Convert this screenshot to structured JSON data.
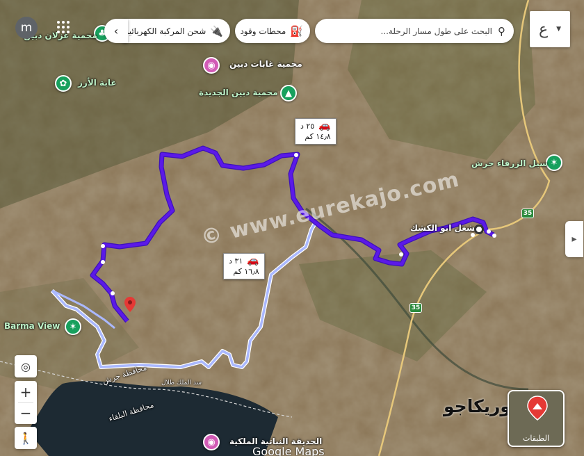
{
  "search": {
    "placeholder": "البحث على طول مسار الرحلة..."
  },
  "chips": {
    "fuel": "محطات وقود",
    "ev": "شحن المركبة الكهربائية"
  },
  "user_initial": "m",
  "language_toggle": "ع",
  "routes": {
    "primary": {
      "time": "٢٥ د",
      "distance": "١٤٫٨ كم"
    },
    "alternate": {
      "time": "٣١ د",
      "distance": "١٦٫٨ كم"
    }
  },
  "places": [
    {
      "name": "محمية غابات دبين",
      "type": "park"
    },
    {
      "name": "غابة الأرز",
      "type": "park"
    },
    {
      "name": "محمية دبين الجديدة",
      "type": "park"
    },
    {
      "name": "سيل الزرقاء جرش",
      "type": "park"
    },
    {
      "name": "مشغل ابو الكشك",
      "type": "origin"
    },
    {
      "name": "Barma View",
      "type": "park"
    },
    {
      "name": "محافظة جرش",
      "type": "area"
    },
    {
      "name": "سد الملك طلال",
      "type": "water"
    },
    {
      "name": "محافظة البلقاء",
      "type": "area"
    },
    {
      "name": "الحديقة النباتية الملكية",
      "type": "park"
    },
    {
      "name": "محمية غزلان دبين",
      "type": "park"
    }
  ],
  "roads": [
    "35",
    "35"
  ],
  "watermark": "© www.eurekajo.com",
  "brand_text": "يوريكاجو",
  "layers_label": "الطبقات",
  "attribution": "Google Maps",
  "colors": {
    "route_primary": "#5b19e8",
    "route_alternate": "#b7c6ff",
    "destination": "#e53935"
  }
}
